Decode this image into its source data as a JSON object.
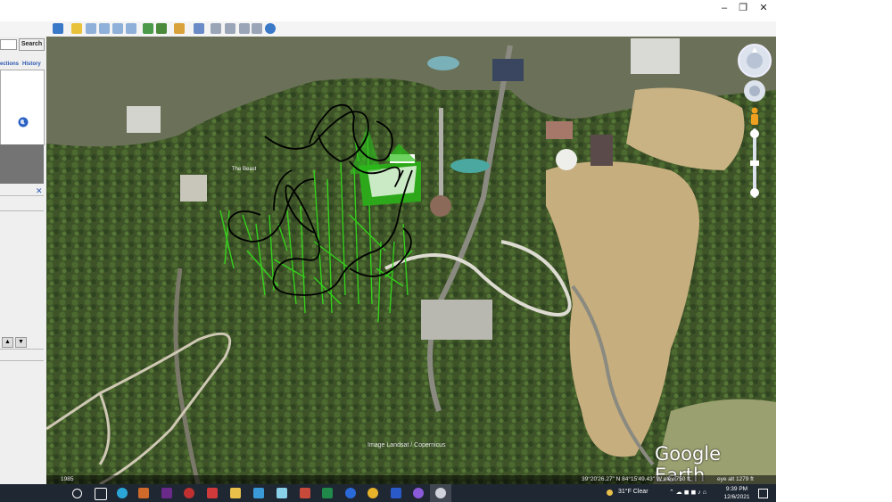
{
  "window": {
    "minimize": "–",
    "maximize": "❐",
    "close": "✕"
  },
  "sidebar": {
    "search_button": "Search",
    "tabs": [
      "ections",
      "History"
    ],
    "close_label": "✕",
    "nav_up": "▲",
    "nav_down": "▼"
  },
  "map": {
    "labels": {
      "beast": "The Beast",
      "attribution": "Image Landsat / Copernicus",
      "logo": "Google Earth"
    },
    "status": {
      "year": "1985",
      "coords": "39°20'26.27\" N   84°15'49.43\" W   elev   750 ft",
      "eye_alt": "eye alt   1279 ft"
    }
  },
  "taskbar": {
    "weather": "31°F  Clear",
    "time": "9:39 PM",
    "date": "12/6/2021"
  },
  "colors": {
    "taskbar": "#1f2733",
    "track": "#000000",
    "supports": "#35d11c"
  }
}
